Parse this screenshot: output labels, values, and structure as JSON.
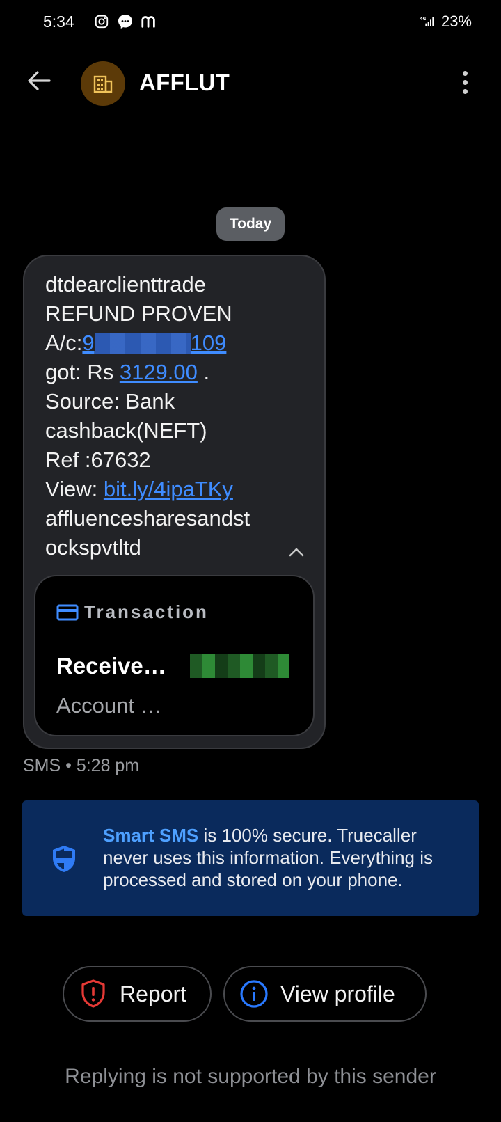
{
  "status_bar": {
    "time": "5:34",
    "battery": "23%",
    "network": "4G"
  },
  "app_bar": {
    "title": "AFFLUT"
  },
  "date_chip": "Today",
  "message": {
    "line1": "dtdearclienttrade",
    "line2": "REFUND PROVEN",
    "ac_prefix": "A/c:",
    "ac_start": "9",
    "ac_end": "109",
    "got_prefix": "got: Rs ",
    "amount": "3129.00",
    "got_suffix": " .",
    "line5": "Source: Bank",
    "line6": "cashback(NEFT)",
    "line7": "Ref :67632",
    "view_prefix": "View: ",
    "view_link": "bit.ly/4ipaTKy",
    "line9": "affluencesharesandst",
    "line10": "ockspvtltd"
  },
  "transaction_card": {
    "label": "Transaction",
    "title": "Receive…",
    "subtitle": "Account …"
  },
  "message_meta": "SMS • 5:28 pm",
  "info_banner": {
    "accent": "Smart SMS",
    "text": " is 100% secure. Truecaller never uses this information. Everything is processed and stored on your phone."
  },
  "actions": {
    "report_label": "Report",
    "profile_label": "View profile"
  },
  "footer_note": "Replying is not supported by this sender",
  "colors": {
    "background": "#000000",
    "bubble": "#222327",
    "link": "#3f8cff",
    "banner": "#0a2a5c",
    "report_red": "#e53935",
    "profile_blue": "#2979ff"
  }
}
